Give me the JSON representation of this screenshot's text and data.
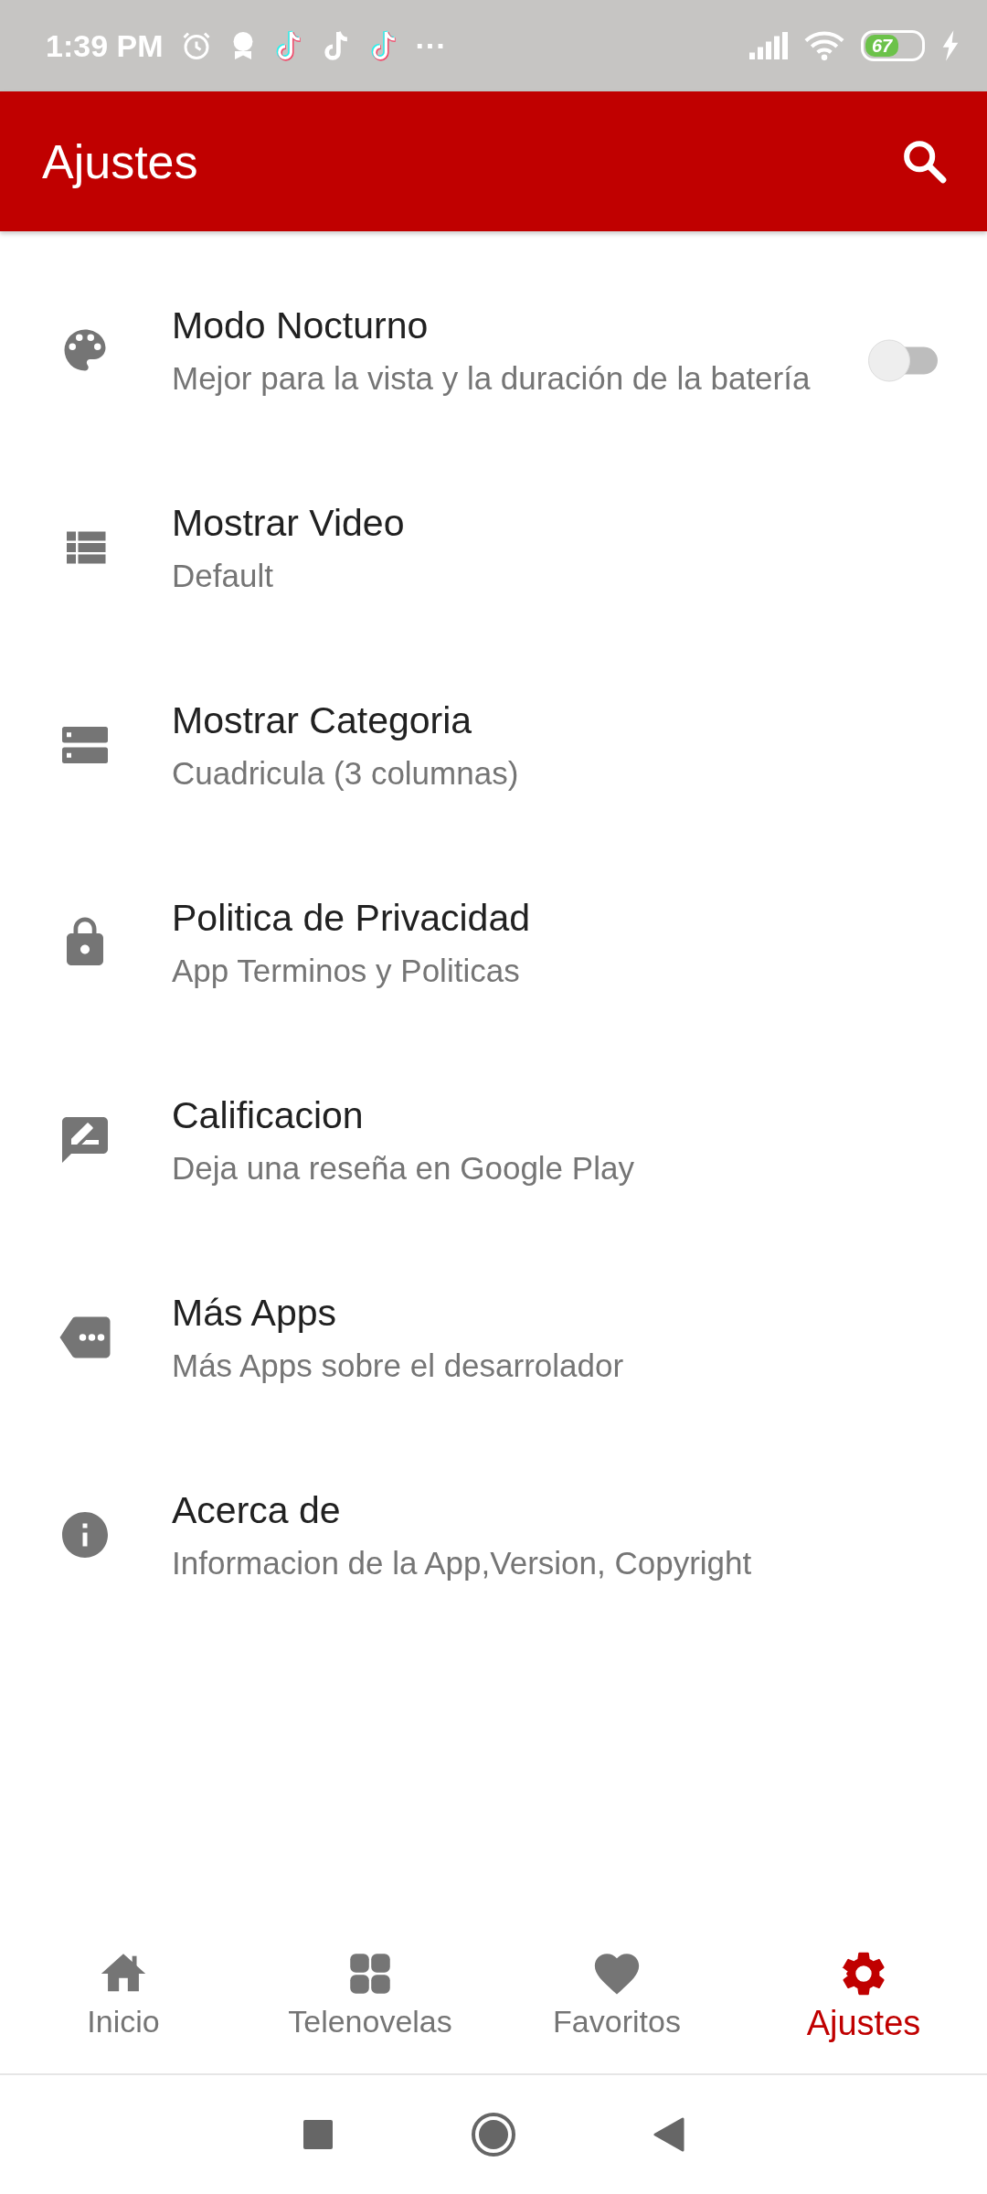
{
  "status_bar": {
    "time": "1:39 PM",
    "more": "···",
    "battery": "67"
  },
  "app_bar": {
    "title": "Ajustes"
  },
  "settings": [
    {
      "kind": "toggle",
      "title": "Modo Nocturno",
      "subtitle": "Mejor para la vista y la duración de la batería",
      "on": false
    },
    {
      "kind": "link",
      "title": "Mostrar Video",
      "subtitle": "Default"
    },
    {
      "kind": "link",
      "title": "Mostrar Categoria",
      "subtitle": "Cuadricula (3 columnas)"
    },
    {
      "kind": "link",
      "title": "Politica de Privacidad",
      "subtitle": "App Terminos y Politicas"
    },
    {
      "kind": "link",
      "title": "Calificacion",
      "subtitle": "Deja una reseña en Google Play"
    },
    {
      "kind": "link",
      "title": "Más Apps",
      "subtitle": "Más Apps sobre el desarrolador"
    },
    {
      "kind": "link",
      "title": "Acerca de",
      "subtitle": "Informacion de la App,Version, Copyright"
    }
  ],
  "bottom_nav": [
    {
      "label": "Inicio",
      "selected": false
    },
    {
      "label": "Telenovelas",
      "selected": false
    },
    {
      "label": "Favoritos",
      "selected": false
    },
    {
      "label": "Ajustes",
      "selected": true
    }
  ]
}
